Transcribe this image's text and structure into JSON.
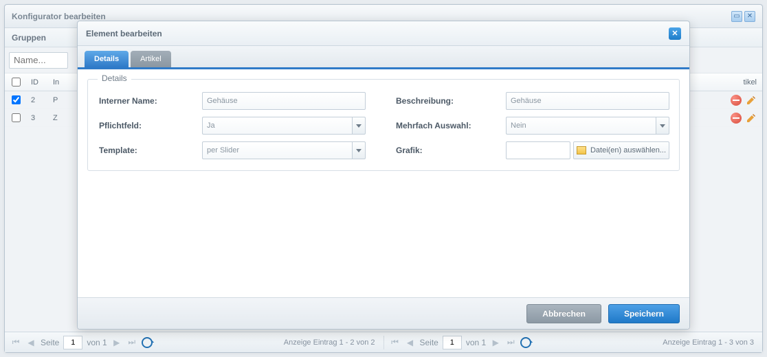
{
  "outer": {
    "title": "Konfigurator bearbeiten",
    "subheader": "Gruppen",
    "name_placeholder": "Name...",
    "columns": {
      "id": "ID",
      "rest": "In"
    },
    "columns_right_tail": "tikel",
    "rows": [
      {
        "checked": true,
        "id": "2",
        "name_initial": "P"
      },
      {
        "checked": false,
        "id": "3",
        "name_initial": "Z"
      }
    ]
  },
  "footer": {
    "page_label": "Seite",
    "page_value": "1",
    "of_label": "von 1",
    "status_left": "Anzeige Eintrag 1 - 2 von 2",
    "status_right": "Anzeige Eintrag 1 - 3 von 3"
  },
  "modal": {
    "title": "Element bearbeiten",
    "tabs": {
      "details": "Details",
      "artikel": "Artikel"
    },
    "fieldset_legend": "Details",
    "labels": {
      "interner_name": "Interner Name:",
      "beschreibung": "Beschreibung:",
      "pflichtfeld": "Pflichtfeld:",
      "mehrfach": "Mehrfach Auswahl:",
      "template": "Template:",
      "grafik": "Grafik:"
    },
    "values": {
      "interner_name": "Gehäuse",
      "beschreibung": "Gehäuse",
      "pflichtfeld": "Ja",
      "mehrfach": "Nein",
      "template": "per Slider"
    },
    "file_button": "Datei(en) auswählen...",
    "buttons": {
      "cancel": "Abbrechen",
      "save": "Speichern"
    }
  }
}
